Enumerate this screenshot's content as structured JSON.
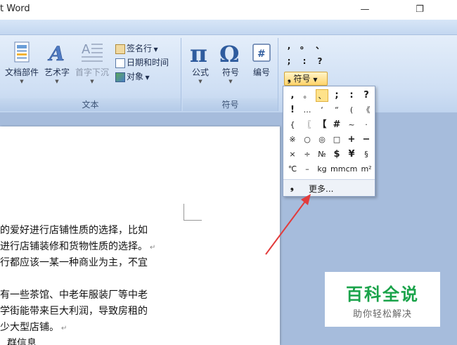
{
  "window": {
    "title": "t Word",
    "minimize": "—",
    "restore": "❐"
  },
  "ribbon": {
    "text_group": {
      "label": "文本",
      "doc_parts": "文档部件",
      "wordart": "艺术字",
      "dropcap": "首字下沉",
      "signature_line": "签名行",
      "date_time": "日期和时间",
      "object": "对象"
    },
    "symbols_group": {
      "label": "符号",
      "equation": "公式",
      "symbol": "符号",
      "number": "编号"
    },
    "mini_gallery": [
      ",",
      "。",
      "、",
      ";",
      ":",
      "?"
    ],
    "symbol_button": "符号"
  },
  "dropdown": {
    "symbols": [
      ",",
      "。",
      "、",
      ";",
      ":",
      "?",
      "!",
      "…",
      "‘",
      "“",
      "(",
      "《",
      "{",
      "〖",
      "【",
      "#",
      "~",
      "·",
      "※",
      "○",
      "◎",
      "□",
      "+",
      "−",
      "×",
      "÷",
      "№",
      "$",
      "¥",
      "§",
      "℃",
      "–",
      "kg",
      "mm",
      "cm",
      "m²"
    ],
    "more_label": "更多..."
  },
  "document": {
    "lines": [
      "的爱好进行店铺性质的选择，比如",
      "进行店铺装修和货物性质的选择。",
      "行都应该一某一种商业为主，不宜",
      "",
      "有一些茶馆、中老年服装厂等中老",
      "学街能带来巨大利润，导致房租的",
      "少大型店铺。",
      "群信息"
    ]
  },
  "watermark": {
    "title": "百科全说",
    "subtitle": "助你轻松解决"
  }
}
